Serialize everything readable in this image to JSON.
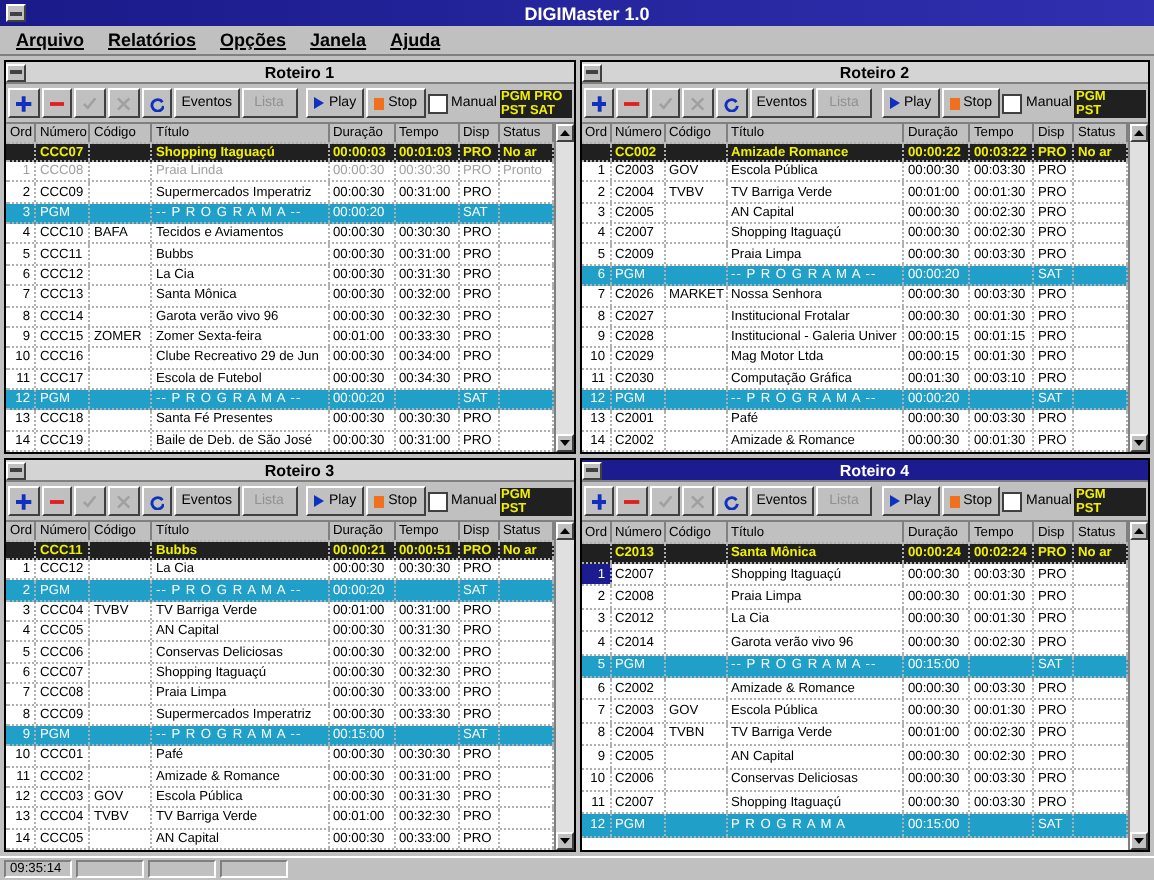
{
  "window": {
    "title": "DIGIMaster 1.0"
  },
  "menu": [
    "Arquivo",
    "Relatórios",
    "Opções",
    "Janela",
    "Ajuda"
  ],
  "panes": [
    {
      "title": "Roteiro 1",
      "active": false,
      "events_button": "Eventos",
      "list_button": {
        "label": "Lista",
        "disabled": true
      },
      "play": "Play",
      "stop": "Stop",
      "manual": {
        "label": "Manual",
        "checked": false
      },
      "pgm": "PGM PRO",
      "pst": "PST SAT",
      "columns": [
        "Ord",
        "Número",
        "Código",
        "Título",
        "Duração",
        "Tempo",
        "Disp",
        "Status"
      ],
      "current": {
        "number": "CCC07",
        "title": "Shopping Itaguaçú",
        "duration": "00:00:03",
        "time": "00:01:03",
        "disp": "PRO",
        "status": "No ar"
      },
      "rows": [
        {
          "kind": "item",
          "ord": "1",
          "number": "CCC08",
          "title": "Praia Linda",
          "duration": "00:00:30",
          "time": "00:30:30",
          "disp": "PRO",
          "status": "Pronto",
          "disabled": true,
          "selected": false
        },
        {
          "kind": "item",
          "ord": "2",
          "number": "CCC09",
          "title": "Supermercados Imperatriz",
          "duration": "00:00:30",
          "time": "00:31:00",
          "disp": "PRO",
          "disabled": false,
          "selected": false
        },
        {
          "kind": "program",
          "ord": "3",
          "number": "PGM",
          "title": "-- P R O G R A M A --",
          "duration": "00:00:20",
          "disp": "SAT",
          "disabled": false,
          "selected": false
        },
        {
          "kind": "item",
          "ord": "4",
          "number": "CCC10",
          "code": "BAFA",
          "title": "Tecidos e Aviamentos",
          "duration": "00:00:30",
          "time": "00:30:30",
          "disp": "PRO",
          "disabled": false,
          "selected": false
        },
        {
          "kind": "item",
          "ord": "5",
          "number": "CCC11",
          "title": "Bubbs",
          "duration": "00:00:30",
          "time": "00:31:00",
          "disp": "PRO",
          "disabled": false,
          "selected": false
        },
        {
          "kind": "item",
          "ord": "6",
          "number": "CCC12",
          "title": "La Cia",
          "duration": "00:00:30",
          "time": "00:31:30",
          "disp": "PRO",
          "disabled": false,
          "selected": false
        },
        {
          "kind": "item",
          "ord": "7",
          "number": "CCC13",
          "title": "Santa Mônica",
          "duration": "00:00:30",
          "time": "00:32:00",
          "disp": "PRO",
          "disabled": false,
          "selected": false
        },
        {
          "kind": "item",
          "ord": "8",
          "number": "CCC14",
          "title": "Garota verão vivo 96",
          "duration": "00:00:30",
          "time": "00:32:30",
          "disp": "PRO",
          "disabled": false,
          "selected": false
        },
        {
          "kind": "item",
          "ord": "9",
          "number": "CCC15",
          "code": "ZOMER",
          "title": "Zomer Sexta-feira",
          "duration": "00:01:00",
          "time": "00:33:30",
          "disp": "PRO",
          "disabled": false,
          "selected": false
        },
        {
          "kind": "item",
          "ord": "10",
          "number": "CCC16",
          "title": "Clube Recreativo 29 de Jun",
          "duration": "00:00:30",
          "time": "00:34:00",
          "disp": "PRO",
          "disabled": false,
          "selected": false
        },
        {
          "kind": "item",
          "ord": "11",
          "number": "CCC17",
          "title": "Escola de Futebol",
          "duration": "00:00:30",
          "time": "00:34:30",
          "disp": "PRO",
          "disabled": false,
          "selected": false
        },
        {
          "kind": "program",
          "ord": "12",
          "number": "PGM",
          "title": "-- P R O G R A M A --",
          "duration": "00:00:20",
          "disp": "SAT",
          "disabled": false,
          "selected": false
        },
        {
          "kind": "item",
          "ord": "13",
          "number": "CCC18",
          "title": "Santa Fé Presentes",
          "duration": "00:00:30",
          "time": "00:30:30",
          "disp": "PRO",
          "disabled": false,
          "selected": false
        },
        {
          "kind": "item",
          "ord": "14",
          "number": "CCC19",
          "title": "Baile de Deb. de São José",
          "duration": "00:00:30",
          "time": "00:31:00",
          "disp": "PRO",
          "disabled": false,
          "selected": false
        }
      ]
    },
    {
      "title": "Roteiro 2",
      "active": false,
      "events_button": "Eventos",
      "list_button": {
        "label": "Lista",
        "disabled": true
      },
      "play": "Play",
      "stop": "Stop",
      "manual": {
        "label": "Manual",
        "checked": false
      },
      "pgm": "PGM",
      "pst": "PST",
      "columns": [
        "Ord",
        "Número",
        "Código",
        "Título",
        "Duração",
        "Tempo",
        "Disp",
        "Status"
      ],
      "current": {
        "number": "CC002",
        "title": "Amizade Romance",
        "duration": "00:00:22",
        "time": "00:03:22",
        "disp": "PRO",
        "status": "No ar"
      },
      "rows": [
        {
          "kind": "item",
          "ord": "1",
          "number": "C2003",
          "code": "GOV",
          "title": "Escola Pública",
          "duration": "00:00:30",
          "time": "00:03:30",
          "disp": "PRO",
          "disabled": false,
          "selected": false
        },
        {
          "kind": "item",
          "ord": "2",
          "number": "C2004",
          "code": "TVBV",
          "title": "TV Barriga Verde",
          "duration": "00:01:00",
          "time": "00:01:30",
          "disp": "PRO",
          "disabled": false,
          "selected": false
        },
        {
          "kind": "item",
          "ord": "3",
          "number": "C2005",
          "title": "AN Capital",
          "duration": "00:00:30",
          "time": "00:02:30",
          "disp": "PRO",
          "disabled": false,
          "selected": false
        },
        {
          "kind": "item",
          "ord": "4",
          "number": "C2007",
          "title": "Shopping Itaguaçú",
          "duration": "00:00:30",
          "time": "00:02:30",
          "disp": "PRO",
          "disabled": false,
          "selected": false
        },
        {
          "kind": "item",
          "ord": "5",
          "number": "C2009",
          "title": "Praia Limpa",
          "duration": "00:00:30",
          "time": "00:03:30",
          "disp": "PRO",
          "disabled": false,
          "selected": false
        },
        {
          "kind": "program",
          "ord": "6",
          "number": "PGM",
          "title": "-- P R O G R A M A --",
          "duration": "00:00:20",
          "disp": "SAT",
          "disabled": false,
          "selected": false
        },
        {
          "kind": "item",
          "ord": "7",
          "number": "C2026",
          "code": "MARKET",
          "title": "Nossa Senhora",
          "duration": "00:00:30",
          "time": "00:03:30",
          "disp": "PRO",
          "disabled": false,
          "selected": false
        },
        {
          "kind": "item",
          "ord": "8",
          "number": "C2027",
          "title": "Institucional Frotalar",
          "duration": "00:00:30",
          "time": "00:01:30",
          "disp": "PRO",
          "disabled": false,
          "selected": false
        },
        {
          "kind": "item",
          "ord": "9",
          "number": "C2028",
          "title": "Institucional - Galeria Univer",
          "duration": "00:00:15",
          "time": "00:01:15",
          "disp": "PRO",
          "disabled": false,
          "selected": false
        },
        {
          "kind": "item",
          "ord": "10",
          "number": "C2029",
          "title": "Mag Motor Ltda",
          "duration": "00:00:15",
          "time": "00:01:30",
          "disp": "PRO",
          "disabled": false,
          "selected": false
        },
        {
          "kind": "item",
          "ord": "11",
          "number": "C2030",
          "title": "Computação Gráfica",
          "duration": "00:01:30",
          "time": "00:03:10",
          "disp": "PRO",
          "disabled": false,
          "selected": false
        },
        {
          "kind": "program",
          "ord": "12",
          "number": "PGM",
          "title": "-- P R O G R A M A --",
          "duration": "00:00:20",
          "disp": "SAT",
          "disabled": false,
          "selected": false
        },
        {
          "kind": "item",
          "ord": "13",
          "number": "C2001",
          "title": "Pafé",
          "duration": "00:00:30",
          "time": "00:03:30",
          "disp": "PRO",
          "disabled": false,
          "selected": false
        },
        {
          "kind": "item",
          "ord": "14",
          "number": "C2002",
          "title": "Amizade & Romance",
          "duration": "00:00:30",
          "time": "00:01:30",
          "disp": "PRO",
          "disabled": false,
          "selected": false
        }
      ]
    },
    {
      "title": "Roteiro 3",
      "active": false,
      "events_button": "Eventos",
      "list_button": {
        "label": "Lista",
        "disabled": true
      },
      "play": "Play",
      "stop": "Stop",
      "manual": {
        "label": "Manual",
        "checked": false
      },
      "pgm": "PGM",
      "pst": "PST",
      "columns": [
        "Ord",
        "Número",
        "Código",
        "Título",
        "Duração",
        "Tempo",
        "Disp",
        "Status"
      ],
      "current": {
        "number": "CCC11",
        "title": "Bubbs",
        "duration": "00:00:21",
        "time": "00:00:51",
        "disp": "PRO",
        "status": "No ar"
      },
      "rows": [
        {
          "kind": "item",
          "ord": "1",
          "number": "CCC12",
          "title": "La Cia",
          "duration": "00:00:30",
          "time": "00:30:30",
          "disp": "PRO",
          "disabled": false,
          "selected": false
        },
        {
          "kind": "program",
          "ord": "2",
          "number": "PGM",
          "title": "-- P R O G R A M A --",
          "duration": "00:00:20",
          "disp": "SAT",
          "disabled": false,
          "selected": false
        },
        {
          "kind": "item",
          "ord": "3",
          "number": "CCC04",
          "code": "TVBV",
          "title": "TV Barriga Verde",
          "duration": "00:01:00",
          "time": "00:31:00",
          "disp": "PRO",
          "disabled": false,
          "selected": false
        },
        {
          "kind": "item",
          "ord": "4",
          "number": "CCC05",
          "title": "AN Capital",
          "duration": "00:00:30",
          "time": "00:31:30",
          "disp": "PRO",
          "disabled": false,
          "selected": false
        },
        {
          "kind": "item",
          "ord": "5",
          "number": "CCC06",
          "title": "Conservas Deliciosas",
          "duration": "00:00:30",
          "time": "00:32:00",
          "disp": "PRO",
          "disabled": false,
          "selected": false
        },
        {
          "kind": "item",
          "ord": "6",
          "number": "CCC07",
          "title": "Shopping Itaguaçú",
          "duration": "00:00:30",
          "time": "00:32:30",
          "disp": "PRO",
          "disabled": false,
          "selected": false
        },
        {
          "kind": "item",
          "ord": "7",
          "number": "CCC08",
          "title": "Praia Limpa",
          "duration": "00:00:30",
          "time": "00:33:00",
          "disp": "PRO",
          "disabled": false,
          "selected": false
        },
        {
          "kind": "item",
          "ord": "8",
          "number": "CCC09",
          "title": "Supermercados Imperatriz",
          "duration": "00:00:30",
          "time": "00:33:30",
          "disp": "PRO",
          "disabled": false,
          "selected": false
        },
        {
          "kind": "program",
          "ord": "9",
          "number": "PGM",
          "title": "-- P R O G R A M A --",
          "duration": "00:15:00",
          "disp": "SAT",
          "disabled": false,
          "selected": false
        },
        {
          "kind": "item",
          "ord": "10",
          "number": "CCC01",
          "title": "Pafé",
          "duration": "00:00:30",
          "time": "00:30:30",
          "disp": "PRO",
          "disabled": false,
          "selected": false
        },
        {
          "kind": "item",
          "ord": "11",
          "number": "CCC02",
          "title": "Amizade & Romance",
          "duration": "00:00:30",
          "time": "00:31:00",
          "disp": "PRO",
          "disabled": false,
          "selected": false
        },
        {
          "kind": "item",
          "ord": "12",
          "number": "CCC03",
          "code": "GOV",
          "title": "Escola Pública",
          "duration": "00:00:30",
          "time": "00:31:30",
          "disp": "PRO",
          "disabled": false,
          "selected": false
        },
        {
          "kind": "item",
          "ord": "13",
          "number": "CCC04",
          "code": "TVBV",
          "title": "TV Barriga Verde",
          "duration": "00:01:00",
          "time": "00:32:30",
          "disp": "PRO",
          "disabled": false,
          "selected": false
        },
        {
          "kind": "item",
          "ord": "14",
          "number": "CCC05",
          "title": "AN Capital",
          "duration": "00:00:30",
          "time": "00:33:00",
          "disp": "PRO",
          "disabled": false,
          "selected": false
        }
      ]
    },
    {
      "title": "Roteiro 4",
      "active": true,
      "events_button": "Eventos",
      "list_button": {
        "label": "Lista",
        "disabled": true
      },
      "play": "Play",
      "stop": "Stop",
      "manual": {
        "label": "Manual",
        "checked": false
      },
      "pgm": "PGM",
      "pst": "PST",
      "columns": [
        "Ord",
        "Número",
        "Código",
        "Título",
        "Duração",
        "Tempo",
        "Disp",
        "Status"
      ],
      "current": {
        "number": "C2013",
        "title": "Santa Mônica",
        "duration": "00:00:24",
        "time": "00:02:24",
        "disp": "PRO",
        "status": "No ar"
      },
      "rows": [
        {
          "kind": "item",
          "ord": "1",
          "number": "C2007",
          "title": "Shopping Itaguaçú",
          "duration": "00:00:30",
          "time": "00:03:30",
          "disp": "PRO",
          "disabled": false,
          "selected": true
        },
        {
          "kind": "item",
          "ord": "2",
          "number": "C2008",
          "title": "Praia Limpa",
          "duration": "00:00:30",
          "time": "00:01:30",
          "disp": "PRO",
          "disabled": false,
          "selected": false
        },
        {
          "kind": "item",
          "ord": "3",
          "number": "C2012",
          "title": "La Cia",
          "duration": "00:00:30",
          "time": "00:01:30",
          "disp": "PRO",
          "disabled": false,
          "selected": false
        },
        {
          "kind": "item",
          "ord": "4",
          "number": "C2014",
          "title": "Garota verão vivo 96",
          "duration": "00:00:30",
          "time": "00:02:30",
          "disp": "PRO",
          "disabled": false,
          "selected": false
        },
        {
          "kind": "program",
          "ord": "5",
          "number": "PGM",
          "title": "-- P R O G R A M A --",
          "duration": "00:15:00",
          "disp": "SAT",
          "disabled": false,
          "selected": false
        },
        {
          "kind": "item",
          "ord": "6",
          "number": "C2002",
          "title": "Amizade & Romance",
          "duration": "00:00:30",
          "time": "00:03:30",
          "disp": "PRO",
          "disabled": false,
          "selected": false
        },
        {
          "kind": "item",
          "ord": "7",
          "number": "C2003",
          "code": "GOV",
          "title": "Escola Pública",
          "duration": "00:00:30",
          "time": "00:01:30",
          "disp": "PRO",
          "disabled": false,
          "selected": false
        },
        {
          "kind": "item",
          "ord": "8",
          "number": "C2004",
          "code": "TVBN",
          "title": "TV Barriga Verde",
          "duration": "00:01:00",
          "time": "00:02:30",
          "disp": "PRO",
          "disabled": false,
          "selected": false
        },
        {
          "kind": "item",
          "ord": "9",
          "number": "C2005",
          "title": "AN Capital",
          "duration": "00:00:30",
          "time": "00:02:30",
          "disp": "PRO",
          "disabled": false,
          "selected": false
        },
        {
          "kind": "item",
          "ord": "10",
          "number": "C2006",
          "title": "Conservas Deliciosas",
          "duration": "00:00:30",
          "time": "00:03:30",
          "disp": "PRO",
          "disabled": false,
          "selected": false
        },
        {
          "kind": "item",
          "ord": "11",
          "number": "C2007",
          "title": "Shopping Itaguaçú",
          "duration": "00:00:30",
          "time": "00:03:30",
          "disp": "PRO",
          "disabled": false,
          "selected": false
        },
        {
          "kind": "program",
          "ord": "12",
          "number": "PGM",
          "title": "P R O G R A M A",
          "duration": "00:15:00",
          "disp": "SAT",
          "disabled": false,
          "selected": false
        }
      ]
    }
  ],
  "status_bar": {
    "clock": "09:35:14"
  }
}
